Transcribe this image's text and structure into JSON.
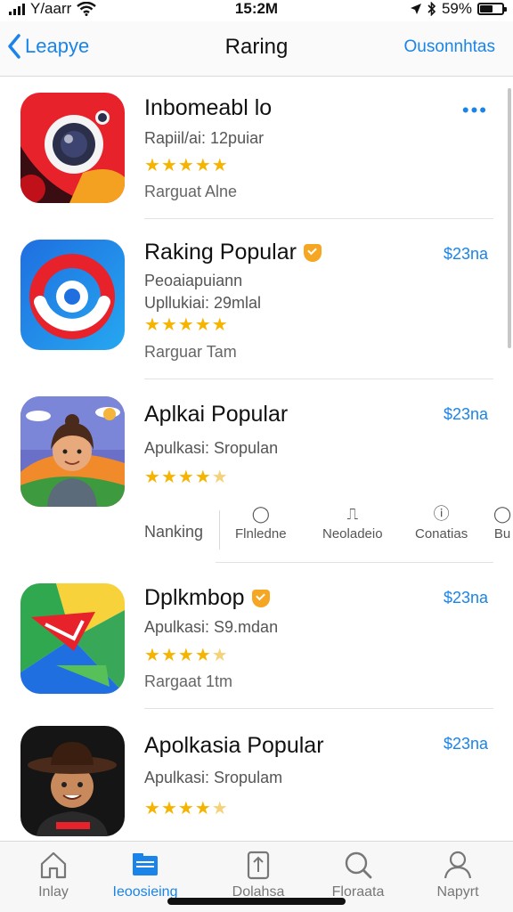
{
  "status_bar": {
    "carrier": "Y/aarr",
    "time": "15:2M",
    "battery": "59%",
    "battery_level": 0.59
  },
  "nav": {
    "back_label": "Leapye",
    "title": "Raring",
    "action_label": "Ousonnhtas"
  },
  "apps": [
    {
      "name": "Inbomeabl lo",
      "subtitle": "Rapiil/ai: 12puiar",
      "rating": 5,
      "meta": "Rarguat  Alne",
      "more": "•••"
    },
    {
      "name": "Raking Popular",
      "subtitle": "Peoaiapuiann",
      "subtitle2": "Upllukiai: 29mlal",
      "rating": 5,
      "meta": "Rarguar  Tam",
      "price": "$23na"
    },
    {
      "name": "Aplkai Popular",
      "subtitle": "Apulkasi: Sropulan",
      "rating": 4.5,
      "price": "$23na"
    },
    {
      "name": "Dplkmbop",
      "subtitle": "Apulkasi: S9.mdan",
      "rating": 4.5,
      "meta": "Rargaat  1tm",
      "price": "$23na"
    },
    {
      "name": "Apolkasia Popular",
      "subtitle": "Apulkasi: Sropulam",
      "rating": 4,
      "price": "$23na"
    }
  ],
  "filters": {
    "label": "Nanking",
    "items": [
      {
        "label": "Flnledne",
        "icon": "circle-icon"
      },
      {
        "label": "Neoladeio",
        "icon": "ticket-icon"
      },
      {
        "label": "Conatias",
        "icon": "info-icon"
      },
      {
        "label": "Bu",
        "icon": "circle-icon"
      }
    ]
  },
  "tabs": [
    {
      "label": "Inlay",
      "icon": "home-icon"
    },
    {
      "label": "Ieoosieing",
      "icon": "folder-icon",
      "active": true
    },
    {
      "label": "Dolahsa",
      "icon": "tablet-icon"
    },
    {
      "label": "Floraata",
      "icon": "search-icon"
    },
    {
      "label": "Napyrt",
      "icon": "person-icon"
    }
  ],
  "colors": {
    "accent": "#1a84e8",
    "star": "#f5b400",
    "badge": "#f5a623"
  }
}
